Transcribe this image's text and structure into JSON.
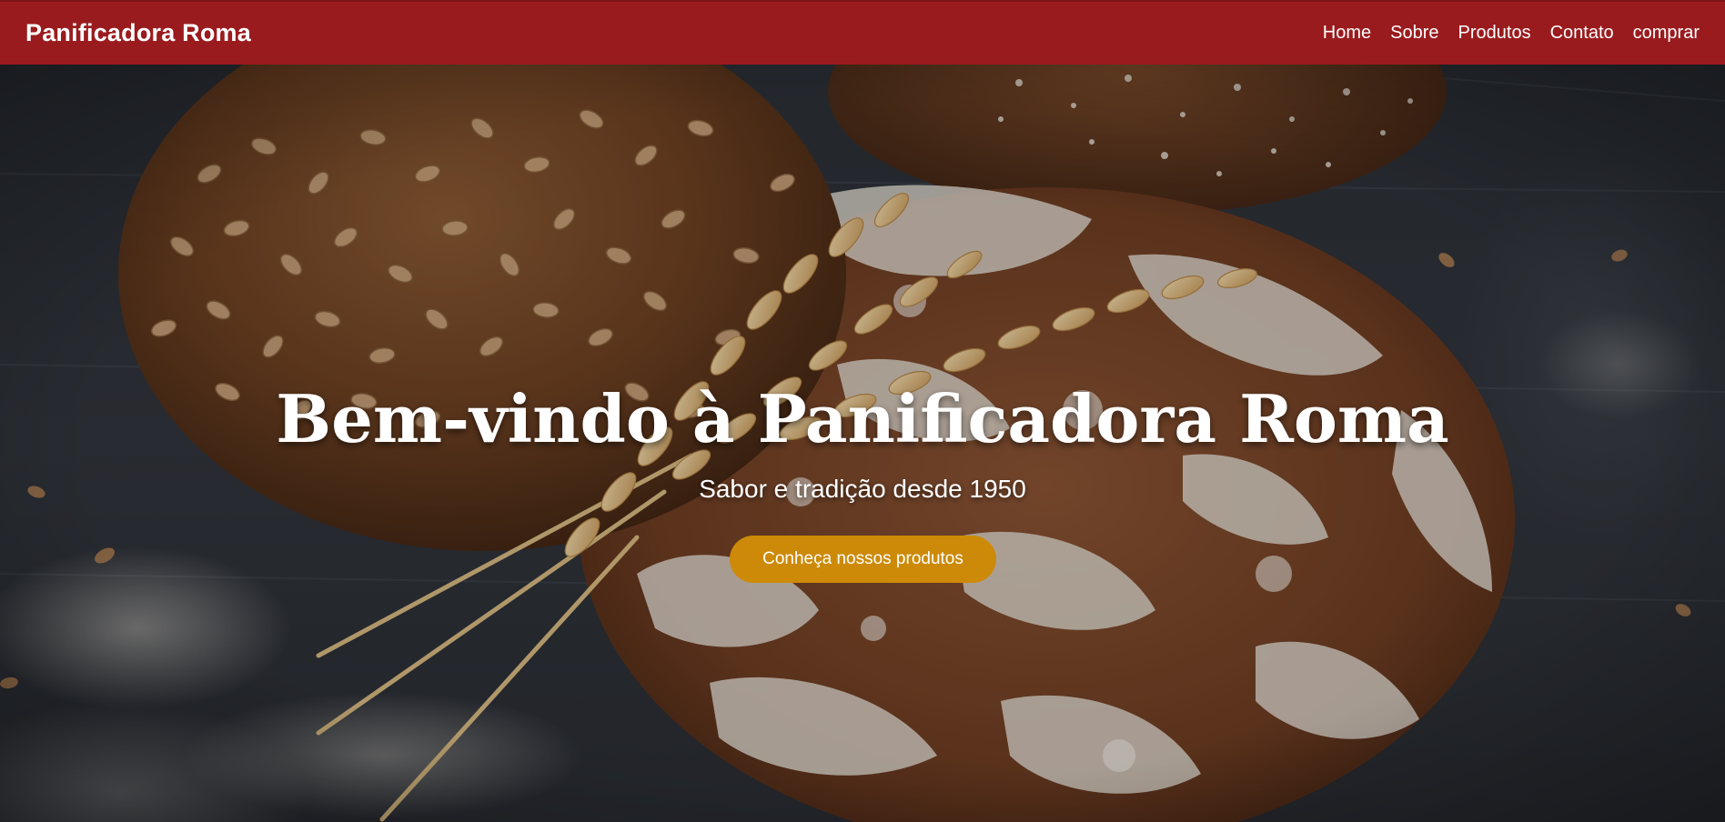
{
  "header": {
    "brand": "Panificadora Roma",
    "nav": [
      {
        "label": "Home"
      },
      {
        "label": "Sobre"
      },
      {
        "label": "Produtos"
      },
      {
        "label": "Contato"
      },
      {
        "label": "comprar"
      }
    ]
  },
  "hero": {
    "title": "Bem-vindo à Panificadora Roma",
    "subtitle": "Sabor e tradição desde 1950",
    "cta_label": "Conheça nossos produtos"
  },
  "colors": {
    "navbar": "#9a1b1e",
    "cta": "#cc8a08",
    "text": "#ffffff"
  }
}
